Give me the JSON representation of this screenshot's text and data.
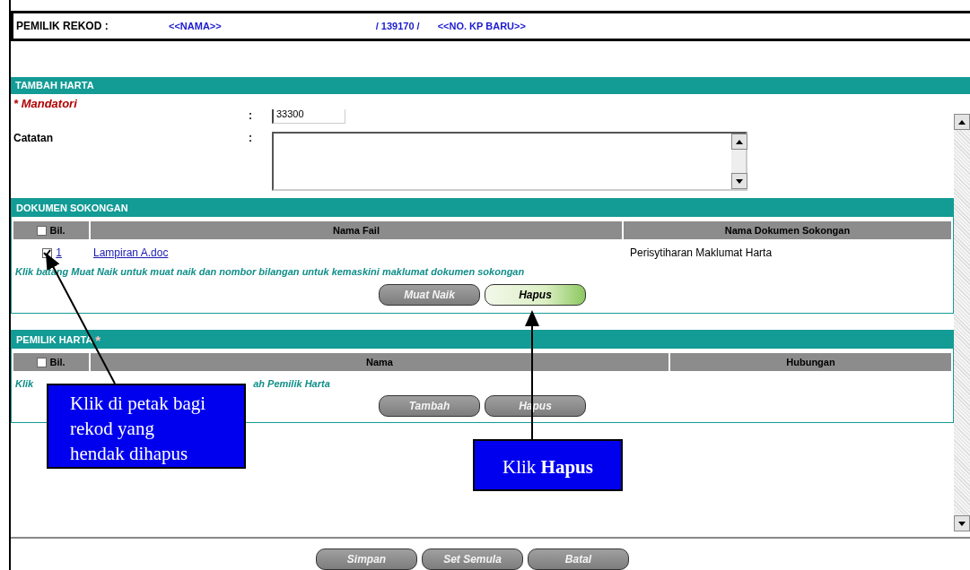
{
  "record_owner": {
    "label": "PEMILIK REKOD :",
    "name": "<<NAMA>>",
    "number": "/ 139170 /",
    "ic_number": "<<NO. KP BARU>>"
  },
  "form": {
    "title": "TAMBAH HARTA",
    "mandatory_note": "* Mandatori",
    "postcode": {
      "value": "33300"
    },
    "notes": {
      "label": "Catatan",
      "colon": ":"
    },
    "postcode_colon": ":"
  },
  "documents": {
    "title": "DOKUMEN SOKONGAN",
    "columns": [
      {
        "label": "Bil.",
        "checked": false
      },
      {
        "label": "Nama Fail"
      },
      {
        "label": "Nama Dokumen Sokongan"
      }
    ],
    "rows": [
      {
        "checked": true,
        "number": "1",
        "file": "Lampiran A.doc",
        "document": "Perisytiharan Maklumat Harta"
      }
    ],
    "hint": "Klik batang Muat Naik untuk muat naik dan nombor bilangan untuk kemaskini maklumat dokumen sokongan",
    "buttons": [
      {
        "label": "Muat Naik",
        "highlighted": false
      },
      {
        "label": "Hapus",
        "highlighted": true
      }
    ]
  },
  "owners": {
    "title": "PEMILIK HARTA",
    "required_mark": "*",
    "columns": [
      {
        "label": "Bil.",
        "checked": false
      },
      {
        "label": "Nama"
      },
      {
        "label": "Hubungan"
      }
    ],
    "hint_parts": [
      "Klik",
      "ah Pemilik Harta"
    ],
    "buttons": [
      {
        "label": "Tambah",
        "highlighted": false
      },
      {
        "label": "Hapus",
        "highlighted": false
      }
    ]
  },
  "footer_buttons": [
    {
      "label": "Simpan"
    },
    {
      "label": "Set Semula"
    },
    {
      "label": "Batal"
    }
  ],
  "callouts": [
    {
      "text": "Klik di petak bagi rekod yang hendak dihapus"
    },
    {
      "text": "Klik **Hapus**"
    }
  ]
}
